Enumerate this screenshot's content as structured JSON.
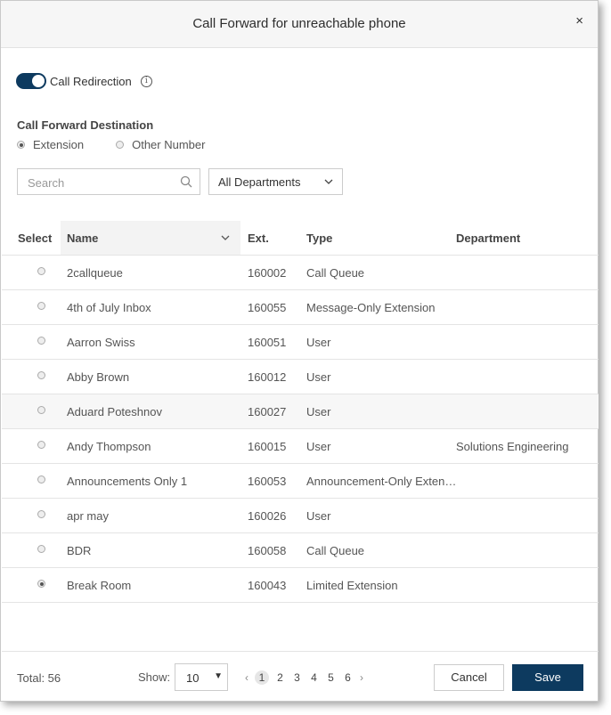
{
  "dialog": {
    "title": "Call Forward for unreachable phone",
    "close_icon": "×"
  },
  "redirection": {
    "label": "Call Redirection",
    "enabled": true,
    "info_icon": "i"
  },
  "destination": {
    "title": "Call Forward Destination",
    "options": [
      {
        "label": "Extension",
        "selected": true
      },
      {
        "label": "Other Number",
        "selected": false
      }
    ]
  },
  "filters": {
    "search_placeholder": "Search",
    "department": "All Departments"
  },
  "table": {
    "headers": {
      "select": "Select",
      "name": "Name",
      "ext": "Ext.",
      "type": "Type",
      "department": "Department"
    },
    "rows": [
      {
        "name": "2callqueue",
        "ext": "160002",
        "type": "Call Queue",
        "department": "",
        "selected": false
      },
      {
        "name": "4th of July Inbox",
        "ext": "160055",
        "type": "Message-Only Extension",
        "department": "",
        "selected": false
      },
      {
        "name": "Aarron Swiss",
        "ext": "160051",
        "type": "User",
        "department": "",
        "selected": false
      },
      {
        "name": "Abby Brown",
        "ext": "160012",
        "type": "User",
        "department": "",
        "selected": false
      },
      {
        "name": "Aduard Poteshnov",
        "ext": "160027",
        "type": "User",
        "department": "",
        "selected": false
      },
      {
        "name": "Andy Thompson",
        "ext": "160015",
        "type": "User",
        "department": "Solutions Engineering",
        "selected": false
      },
      {
        "name": "Announcements Only 1",
        "ext": "160053",
        "type": "Announcement-Only Exten…",
        "department": "",
        "selected": false
      },
      {
        "name": "apr may",
        "ext": "160026",
        "type": "User",
        "department": "",
        "selected": false
      },
      {
        "name": "BDR",
        "ext": "160058",
        "type": "Call Queue",
        "department": "",
        "selected": false
      },
      {
        "name": "Break Room",
        "ext": "160043",
        "type": "Limited Extension",
        "department": "",
        "selected": true
      }
    ]
  },
  "footer": {
    "total": "Total: 56",
    "show_label": "Show:",
    "show_value": "10",
    "pages": [
      "1",
      "2",
      "3",
      "4",
      "5",
      "6"
    ],
    "current_page": "1",
    "prev": "‹",
    "next": "›",
    "cancel": "Cancel",
    "save": "Save"
  },
  "colors": {
    "primary": "#0d3a5f"
  }
}
